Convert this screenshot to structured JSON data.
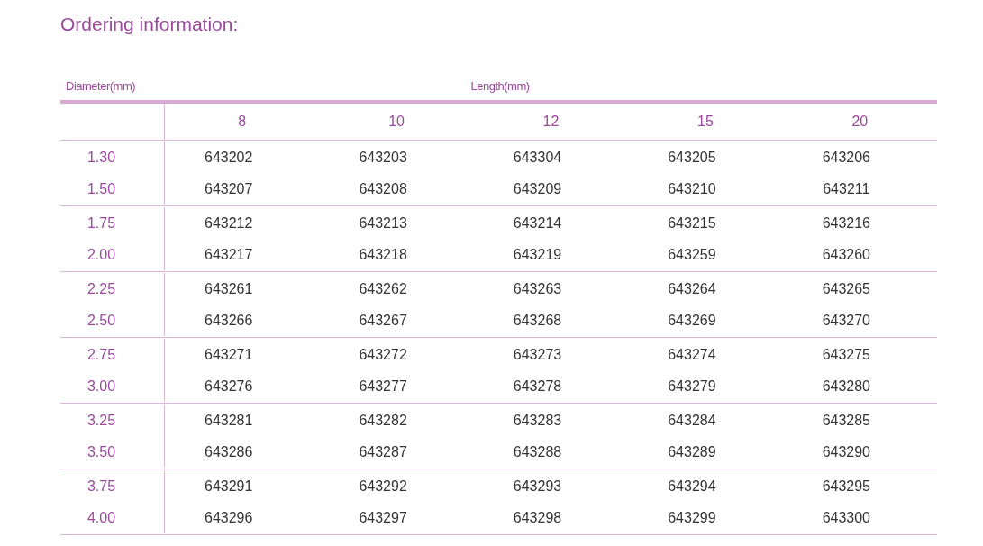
{
  "title": "Ordering information:",
  "table": {
    "diameter_label": "Diameter(mm)",
    "length_label": "Length(mm)",
    "columns": [
      "8",
      "10",
      "12",
      "15",
      "20"
    ],
    "groups": [
      [
        {
          "diameter": "1.30",
          "codes": [
            "643202",
            "643203",
            "643304",
            "643205",
            "643206"
          ]
        },
        {
          "diameter": "1.50",
          "codes": [
            "643207",
            "643208",
            "643209",
            "643210",
            "643211"
          ]
        }
      ],
      [
        {
          "diameter": "1.75",
          "codes": [
            "643212",
            "643213",
            "643214",
            "643215",
            "643216"
          ]
        },
        {
          "diameter": "2.00",
          "codes": [
            "643217",
            "643218",
            "643219",
            "643259",
            "643260"
          ]
        }
      ],
      [
        {
          "diameter": "2.25",
          "codes": [
            "643261",
            "643262",
            "643263",
            "643264",
            "643265"
          ]
        },
        {
          "diameter": "2.50",
          "codes": [
            "643266",
            "643267",
            "643268",
            "643269",
            "643270"
          ]
        }
      ],
      [
        {
          "diameter": "2.75",
          "codes": [
            "643271",
            "643272",
            "643273",
            "643274",
            "643275"
          ]
        },
        {
          "diameter": "3.00",
          "codes": [
            "643276",
            "643277",
            "643278",
            "643279",
            "643280"
          ]
        }
      ],
      [
        {
          "diameter": "3.25",
          "codes": [
            "643281",
            "643282",
            "643283",
            "643284",
            "643285"
          ]
        },
        {
          "diameter": "3.50",
          "codes": [
            "643286",
            "643287",
            "643288",
            "643289",
            "643290"
          ]
        }
      ],
      [
        {
          "diameter": "3.75",
          "codes": [
            "643291",
            "643292",
            "643293",
            "643294",
            "643295"
          ]
        },
        {
          "diameter": "4.00",
          "codes": [
            "643296",
            "643297",
            "643298",
            "643299",
            "643300"
          ]
        }
      ]
    ]
  }
}
